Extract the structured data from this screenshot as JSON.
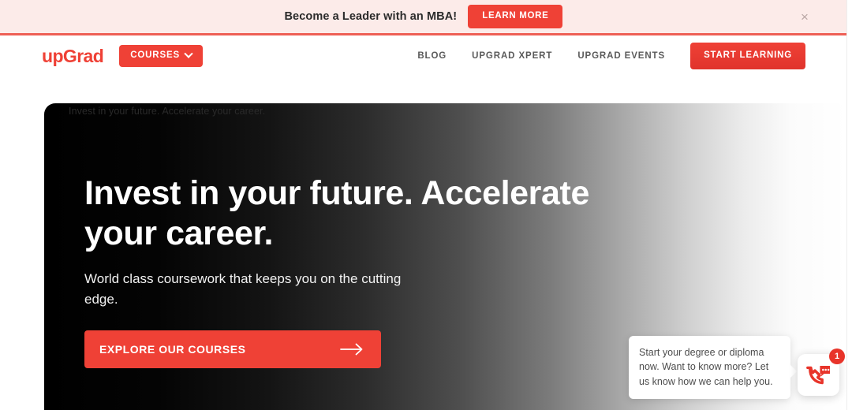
{
  "colors": {
    "brand_red": "#EF4136",
    "banner_bg": "#FCEBE9",
    "banner_border": "#EE5F55",
    "nav_link": "#5A5A5A",
    "badge_red": "#E8342A",
    "close_gray": "#7C8A95"
  },
  "promo_banner": {
    "text": "Become a Leader with an MBA!",
    "cta_label": "LEARN MORE",
    "close_icon": "close-icon",
    "close_glyph": "×"
  },
  "nav": {
    "logo": "upGrad",
    "courses_label": "COURSES",
    "courses_chevron_icon": "chevron-down-icon",
    "links": [
      {
        "label": "BLOG"
      },
      {
        "label": "UPGRAD XPERT"
      },
      {
        "label": "UPGRAD EVENTS"
      }
    ],
    "start_learning_label": "START LEARNING"
  },
  "hero": {
    "alt_text": "Invest in your future. Accelerate your career.",
    "title": "Invest in your future. Accelerate your career.",
    "subtitle": "World class coursework that keeps you on the cutting edge.",
    "cta_label": "EXPLORE OUR COURSES",
    "cta_arrow_icon": "arrow-right-icon"
  },
  "chat_widget": {
    "tooltip_text": "Start your degree or diploma now. Want to know more? Let us know how we can help you.",
    "tooltip_close_icon": "close-icon",
    "launcher_icon": "phone-chat-icon",
    "badge_count": "1"
  }
}
